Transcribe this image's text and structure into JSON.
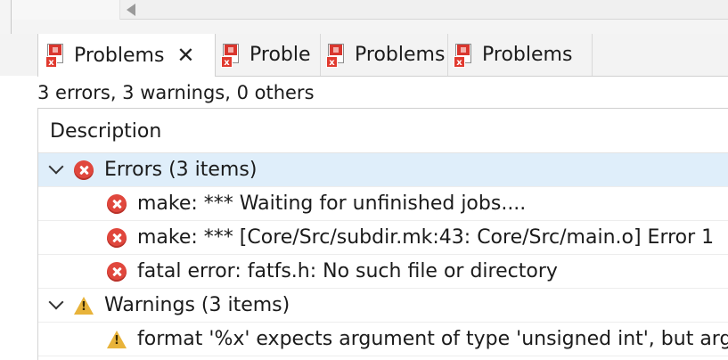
{
  "tabs": [
    {
      "label": "Problems",
      "active": true,
      "close_icon": "close-icon"
    },
    {
      "label": "Proble"
    },
    {
      "label": "Problems"
    },
    {
      "label": "Problems"
    }
  ],
  "summary": "3 errors, 3 warnings, 0 others",
  "table": {
    "column_header": "Description",
    "errors_group": {
      "label": "Errors (3 items)",
      "items": [
        "make: *** Waiting for unfinished jobs....",
        "make: *** [Core/Src/subdir.mk:43: Core/Src/main.o] Error 1",
        "fatal error: fatfs.h: No such file or directory"
      ]
    },
    "warnings_group": {
      "label": "Warnings (3 items)",
      "items": [
        "format '%x' expects argument of type 'unsigned int', but argur"
      ]
    }
  },
  "colors": {
    "selected_row": "#dfeefa",
    "error_red": "#e0473d",
    "warning_yellow": "#e8b33a"
  }
}
